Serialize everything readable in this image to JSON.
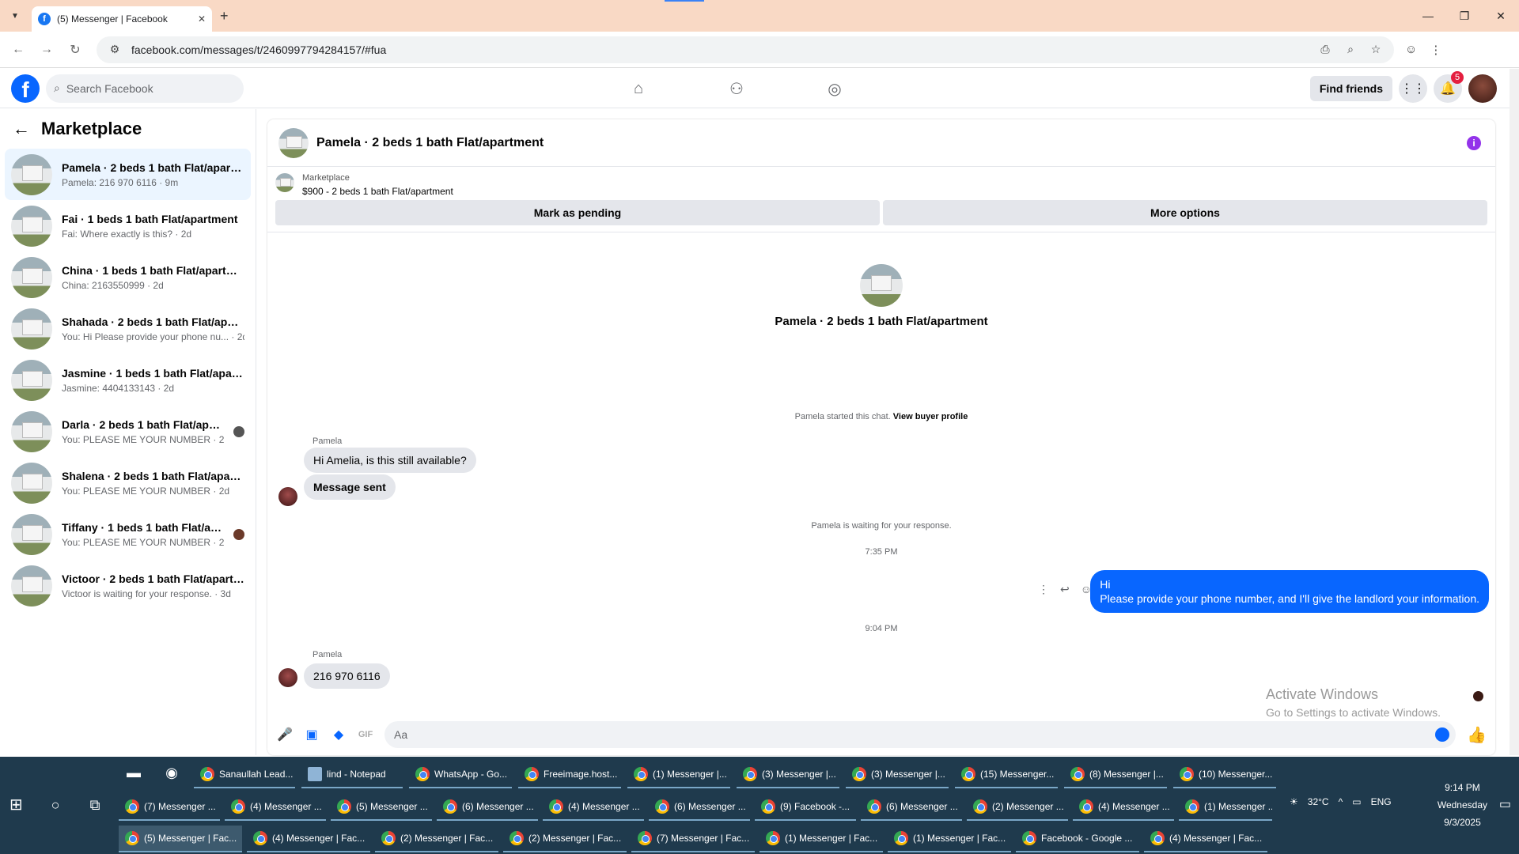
{
  "browser": {
    "tab_title": "(5) Messenger | Facebook",
    "url": "facebook.com/messages/t/2460997794284157/#fua",
    "new_tab": "+",
    "favicon": "f"
  },
  "facebook": {
    "logo": "f",
    "search_placeholder": "Search Facebook",
    "find_friends": "Find friends",
    "notifications_count": "5"
  },
  "sidebar": {
    "title": "Marketplace",
    "conversations": [
      {
        "name": "Pamela · 2 beds 1 bath Flat/apartm...",
        "preview": "Pamela: 216 970 6116 · 9m"
      },
      {
        "name": "Fai · 1 beds 1 bath Flat/apartment",
        "preview": "Fai: Where exactly is this? · 2d"
      },
      {
        "name": "China · 1 beds 1 bath Flat/apartment",
        "preview": "China: 2163550999 · 2d"
      },
      {
        "name": "Shahada · 2 beds 1 bath Flat/apart...",
        "preview": "You: Hi Please provide your phone nu... · 2d"
      },
      {
        "name": "Jasmine · 1 beds 1 bath Flat/apart...",
        "preview": "Jasmine: 4404133143 · 2d"
      },
      {
        "name": "Darla · 2 beds 1 bath Flat/apart...",
        "preview": "You: PLEASE ME YOUR NUMBER · 2d"
      },
      {
        "name": "Shalena · 2 beds 1 bath Flat/apart...",
        "preview": "You: PLEASE ME YOUR NUMBER · 2d"
      },
      {
        "name": "Tiffany · 1 beds 1 bath Flat/apart...",
        "preview": "You: PLEASE ME YOUR NUMBER · 2d"
      },
      {
        "name": "Victoor · 2 beds 1 bath Flat/apartm...",
        "preview": "Victoor is waiting for your response. · 3d"
      }
    ]
  },
  "chat": {
    "header_title": "Pamela · 2 beds 1 bath Flat/apartment",
    "listing_label": "Marketplace",
    "listing_detail": "$900 - 2 beds 1 bath Flat/apartment",
    "mark_pending": "Mark as pending",
    "more_options": "More options",
    "center_title": "Pamela · 2 beds 1 bath Flat/apartment",
    "started_text": "Pamela started this chat.",
    "view_buyer": "View buyer profile",
    "sender_name_1": "Pamela",
    "msg_1": "Hi Amelia, is this still available?",
    "msg_2": "Message sent",
    "waiting_text": "Pamela is waiting for your response.",
    "time_1": "7:35 PM",
    "out_line_1": "Hi",
    "out_line_2": "Please provide your phone number, and I'll give the landlord your information.",
    "time_2": "9:04 PM",
    "sender_name_2": "Pamela",
    "msg_3": "216 970 6116",
    "composer_placeholder": "Aa",
    "gif_label": "GIF"
  },
  "watermark": {
    "line1": "Activate Windows",
    "line2": "Go to Settings to activate Windows."
  },
  "taskbar": {
    "row1": [
      "Sanaullah Lead...",
      "lind - Notepad",
      "WhatsApp - Go...",
      "Freeimage.host...",
      "(1) Messenger |...",
      "(3) Messenger |...",
      "(3) Messenger |...",
      "(15) Messenger...",
      "(8) Messenger |...",
      "(10) Messenger..."
    ],
    "row2": [
      "(7) Messenger ...",
      "(4) Messenger ...",
      "(5) Messenger ...",
      "(6) Messenger ...",
      "(4) Messenger ...",
      "(6) Messenger ...",
      "(9) Facebook -...",
      "(6) Messenger ...",
      "(2) Messenger ...",
      "(4) Messenger ...",
      "(1) Messenger ..."
    ],
    "row3": [
      "(5) Messenger | Fac...",
      "(4) Messenger | Fac...",
      "(2) Messenger | Fac...",
      "(2) Messenger | Fac...",
      "(7) Messenger | Fac...",
      "(1) Messenger | Fac...",
      "(1) Messenger | Fac...",
      "Facebook - Google ...",
      "(4) Messenger | Fac..."
    ],
    "weather": "32°C",
    "lang": "ENG",
    "time": "9:14 PM",
    "day": "Wednesday",
    "date": "9/3/2025"
  }
}
